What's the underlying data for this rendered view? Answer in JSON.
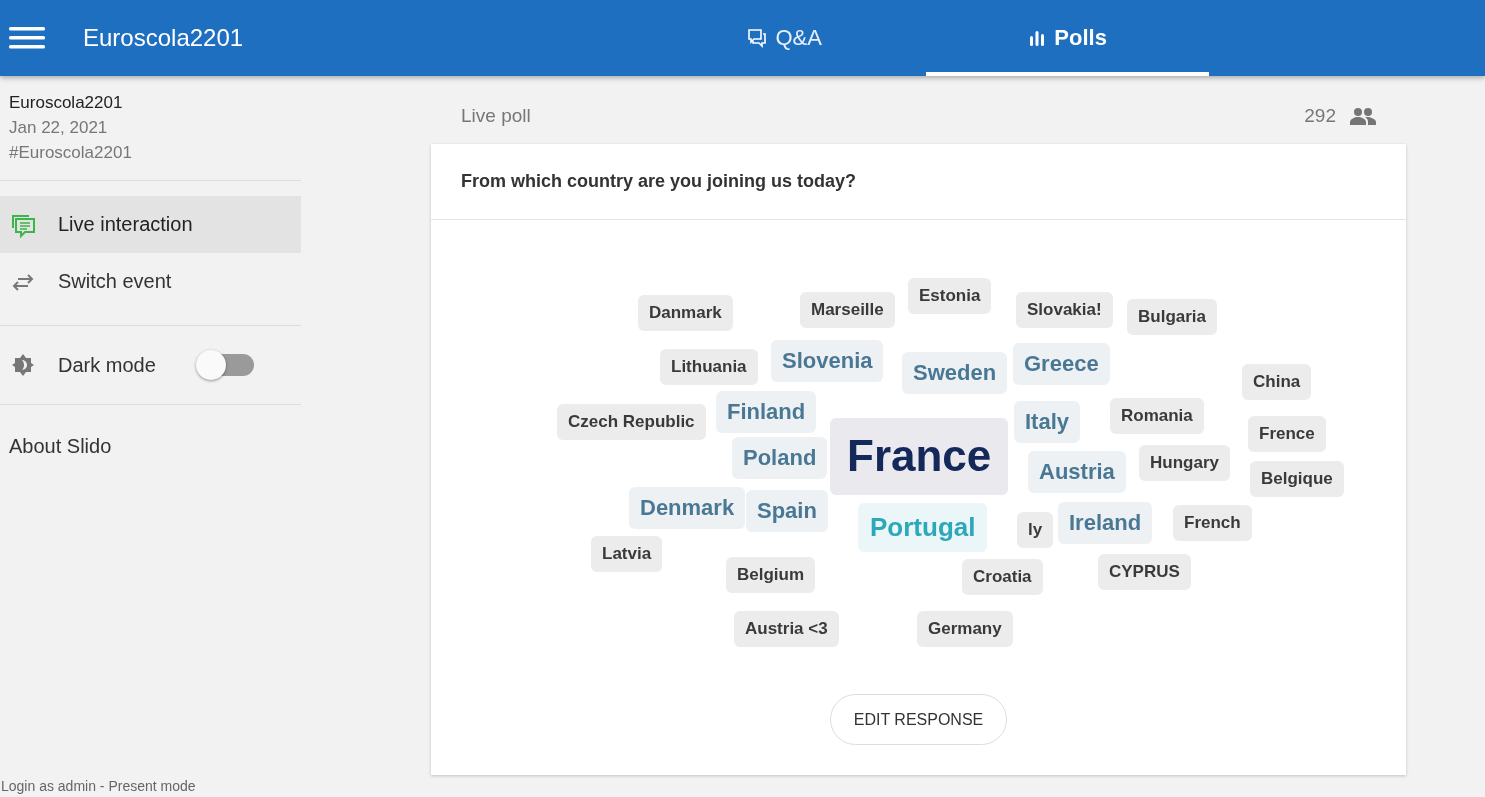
{
  "header": {
    "title": "Euroscola2201"
  },
  "tabs": [
    {
      "label": "Q&A",
      "kind": "qa",
      "selected": false
    },
    {
      "label": "Polls",
      "kind": "polls",
      "selected": true
    }
  ],
  "sidebar": {
    "event_name": "Euroscola2201",
    "date": "Jan 22, 2021",
    "code": "#Euroscola2201",
    "items": [
      {
        "label": "Live interaction",
        "kind": "live",
        "selected": true
      },
      {
        "label": "Switch event",
        "kind": "switch",
        "selected": false
      }
    ],
    "dark_mode": {
      "label": "Dark mode",
      "on": false
    },
    "about": "About Slido",
    "footer": "Login as admin - Present mode"
  },
  "poll": {
    "status": "Live poll",
    "participants": "292",
    "question": "From which country are you joining us today?",
    "words": [
      {
        "text": "Danmark",
        "kind": "small"
      },
      {
        "text": "Marseille",
        "kind": "small"
      },
      {
        "text": "Estonia",
        "kind": "small"
      },
      {
        "text": "Slovakia!",
        "kind": "small"
      },
      {
        "text": "Bulgaria",
        "kind": "small"
      },
      {
        "text": "Lithuania",
        "kind": "small"
      },
      {
        "text": "Slovenia",
        "kind": "medium"
      },
      {
        "text": "Sweden",
        "kind": "medium"
      },
      {
        "text": "Greece",
        "kind": "medium"
      },
      {
        "text": "China",
        "kind": "small"
      },
      {
        "text": "Czech Republic",
        "kind": "small"
      },
      {
        "text": "Finland",
        "kind": "medium"
      },
      {
        "text": "Italy",
        "kind": "medium"
      },
      {
        "text": "Romania",
        "kind": "small"
      },
      {
        "text": "Frence",
        "kind": "small"
      },
      {
        "text": "Poland",
        "kind": "medium"
      },
      {
        "text": "France",
        "kind": "top"
      },
      {
        "text": "Austria",
        "kind": "medium"
      },
      {
        "text": "Hungary",
        "kind": "small"
      },
      {
        "text": "Belgique",
        "kind": "small"
      },
      {
        "text": "Denmark",
        "kind": "medium"
      },
      {
        "text": "Spain",
        "kind": "medium"
      },
      {
        "text": "Portugal",
        "kind": "second"
      },
      {
        "text": "ly",
        "kind": "small"
      },
      {
        "text": "Ireland",
        "kind": "medium"
      },
      {
        "text": "French",
        "kind": "small"
      },
      {
        "text": "Latvia",
        "kind": "small"
      },
      {
        "text": "Belgium",
        "kind": "small"
      },
      {
        "text": "Croatia",
        "kind": "small"
      },
      {
        "text": "CYPRUS",
        "kind": "small"
      },
      {
        "text": "Austria <3",
        "kind": "small"
      },
      {
        "text": "Germany",
        "kind": "small"
      }
    ],
    "edit_button": "EDIT RESPONSE"
  }
}
